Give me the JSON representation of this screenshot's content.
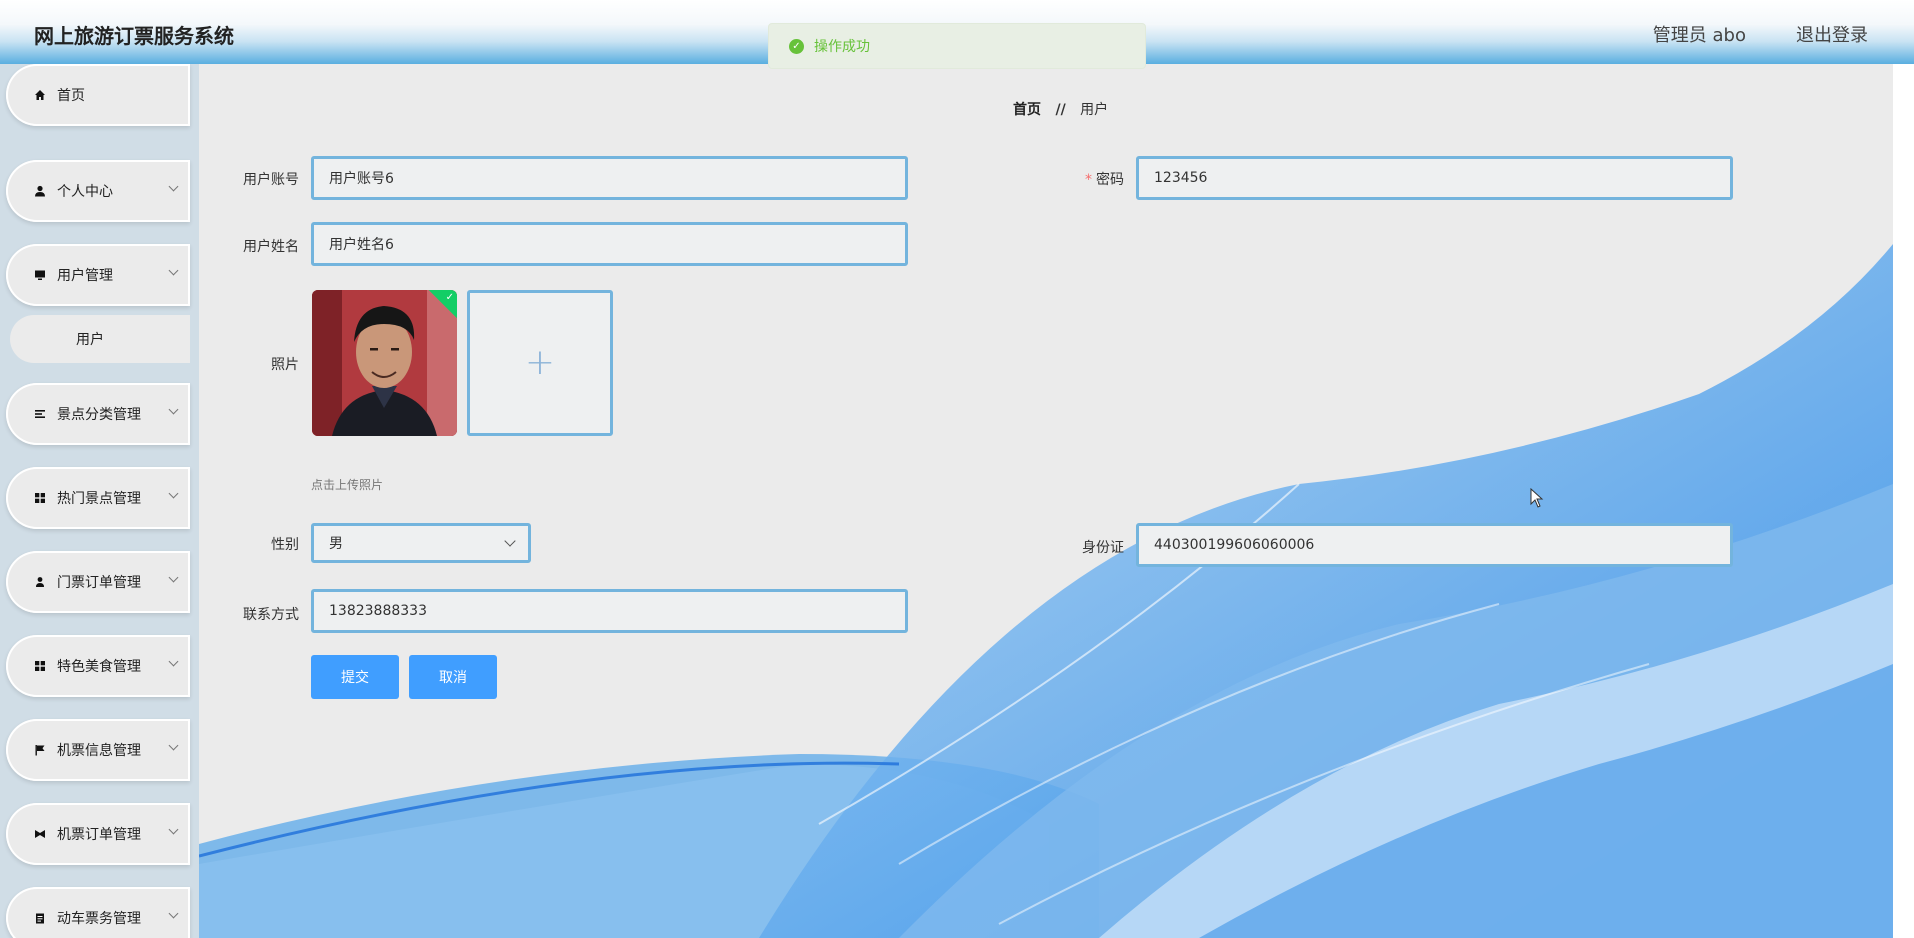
{
  "header": {
    "title": "网上旅游订票服务系统",
    "admin_label": "管理员 abo",
    "logout_label": "退出登录"
  },
  "toast": {
    "message": "操作成功",
    "icon": "success-check-icon",
    "color": "#67c23a"
  },
  "sidebar": {
    "items": [
      {
        "label": "首页",
        "icon": "home-icon"
      },
      {
        "label": "个人中心",
        "icon": "user-icon"
      },
      {
        "label": "用户管理",
        "icon": "monitor-icon"
      },
      {
        "label": "景点分类管理",
        "icon": "list-icon"
      },
      {
        "label": "热门景点管理",
        "icon": "grid-icon"
      },
      {
        "label": "门票订单管理",
        "icon": "person-icon"
      },
      {
        "label": "特色美食管理",
        "icon": "grid-icon"
      },
      {
        "label": "机票信息管理",
        "icon": "flag-icon"
      },
      {
        "label": "机票订单管理",
        "icon": "bowtie-icon"
      },
      {
        "label": "动车票务管理",
        "icon": "document-icon"
      }
    ],
    "submenu": {
      "label": "用户"
    }
  },
  "breadcrumb": {
    "home": "首页",
    "separator": "//",
    "current": "用户"
  },
  "form": {
    "account": {
      "label": "用户账号",
      "value": "用户账号6"
    },
    "password": {
      "label": "密码",
      "required_mark": "*",
      "value": "123456"
    },
    "name": {
      "label": "用户姓名",
      "value": "用户姓名6"
    },
    "photo": {
      "label": "照片",
      "tip": "点击上传照片"
    },
    "gender": {
      "label": "性别",
      "value": "男"
    },
    "id_card": {
      "label": "身份证",
      "value": "440300199606060006"
    },
    "contact": {
      "label": "联系方式",
      "value": "13823888333"
    },
    "submit_label": "提交",
    "cancel_label": "取消"
  },
  "colors": {
    "accent": "#409eff",
    "field_border": "#73b4dd",
    "success": "#67c23a"
  }
}
